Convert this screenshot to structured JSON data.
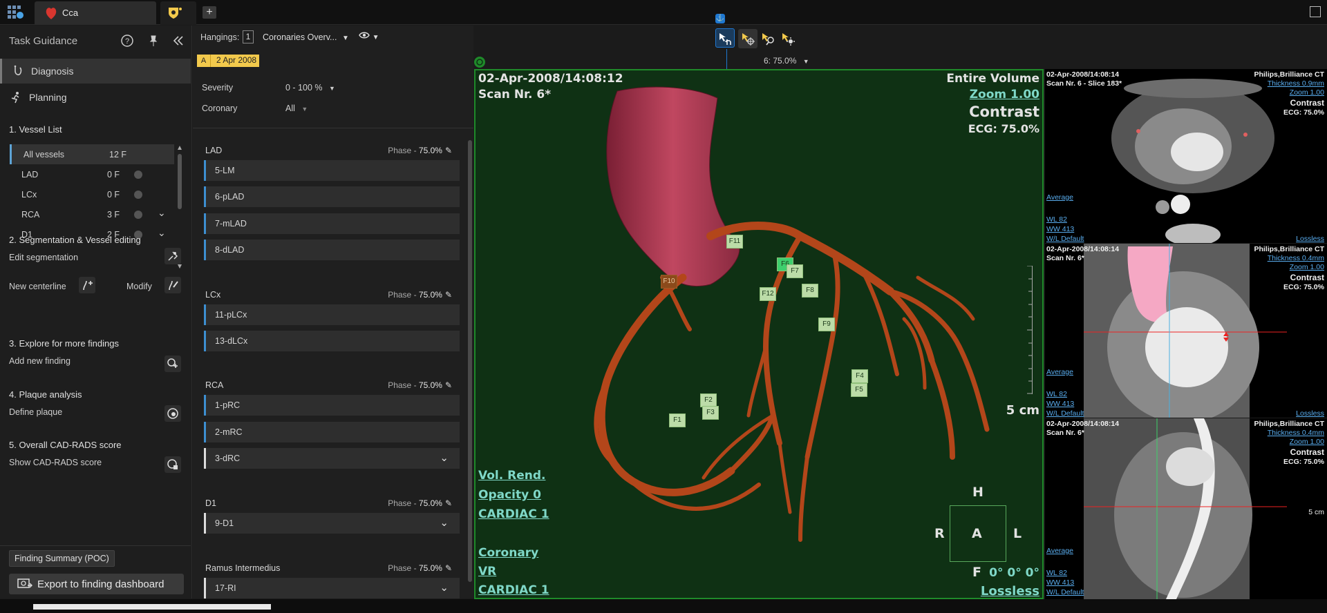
{
  "topbar": {
    "tab_title": "Cca",
    "new_tab_symbol": "+"
  },
  "left": {
    "title": "Task Guidance",
    "nav": [
      {
        "label": "Diagnosis",
        "icon": "diagnosis-icon",
        "active": true
      },
      {
        "label": "Planning",
        "icon": "planning-icon",
        "active": false
      }
    ],
    "sections": {
      "s1": "1.  Vessel List",
      "s2": "2.  Segmentation & Vessel editing",
      "s2_row1": "Edit segmentation",
      "s2_row2a": "New centerline",
      "s2_row2b": "Modify",
      "s3": "3.  Explore for more findings",
      "s3_row": "Add new finding",
      "s4": "4.  Plaque analysis",
      "s4_row": "Define plaque",
      "s5": "5.  Overall CAD-RADS score",
      "s5_row": "Show CAD-RADS score"
    },
    "vessels": [
      {
        "name": "All vessels",
        "count": "12 F"
      },
      {
        "name": "LAD",
        "count": "0 F"
      },
      {
        "name": "LCx",
        "count": "0 F"
      },
      {
        "name": "RCA",
        "count": "3 F"
      },
      {
        "name": "D1",
        "count": "2 F"
      }
    ],
    "finding_summary": "Finding Summary (POC)",
    "export": "Export to finding dashboard"
  },
  "mid": {
    "hangings_label": "Hangings:",
    "hangings_value": "1",
    "hanging_select": "Coronaries Overv...",
    "date_chip": "2 Apr 2008",
    "date_badge": "A",
    "severity_label": "Severity",
    "severity_value": "0 - 100 %",
    "coronary_label": "Coronary",
    "coronary_value": "All",
    "phase_prefix": "Phase - ",
    "phase_value": "75.0%",
    "groups": [
      {
        "title": "LAD",
        "rows": [
          "5-LM",
          "6-pLAD",
          "7-mLAD",
          "8-dLAD"
        ]
      },
      {
        "title": "LCx",
        "rows": [
          "11-pLCx",
          "13-dLCx"
        ]
      },
      {
        "title": "RCA",
        "rows": [
          "1-pRC",
          "2-mRC",
          "3-dRC"
        ]
      },
      {
        "title": "D1",
        "rows": [
          "9-D1"
        ]
      },
      {
        "title": "Ramus Intermedius",
        "rows": [
          "17-RI"
        ]
      }
    ]
  },
  "center": {
    "phase_select": "6: 75.0%"
  },
  "viewport": {
    "date": "02-Apr-2008/14:08:12",
    "scan": "Scan Nr. 6*",
    "volume": "Entire Volume",
    "zoom": "Zoom 1.00",
    "contrast": "Contrast",
    "ecg": "ECG: 75.0%",
    "scale": "5 cm",
    "render1": "Vol. Rend.",
    "render2": "Opacity  0",
    "render3": "CARDIAC 1",
    "render4": "Coronary",
    "render5": "VR",
    "render6": "CARDIAC 1",
    "orient_top": "H",
    "orient_left": "R",
    "orient_center": "A",
    "orient_right": "L",
    "orient_bottom": "F",
    "angles": "0° 0° 0°",
    "compression": "Lossless",
    "findings": [
      "F1",
      "F2",
      "F3",
      "F4",
      "F5",
      "F6",
      "F7",
      "F8",
      "F9",
      "F10",
      "F11",
      "F12"
    ]
  },
  "thumbs": [
    {
      "date": "02-Apr-2008/14:08:14",
      "scan": "Scan Nr. 6 - Slice 183*",
      "vendor": "Philips,Brilliance CT",
      "thickness": "Thickness 0.9mm",
      "zoom": "Zoom 1.00",
      "contrast": "Contrast",
      "ecg": "ECG: 75.0%",
      "average": "Average",
      "wl": "WL      82",
      "ww": "WW     413",
      "wl_default": "W/L Default",
      "lossless": "Lossless"
    },
    {
      "date": "02-Apr-2008/14:08:14",
      "scan": "Scan Nr. 6*",
      "vendor": "Philips,Brilliance CT",
      "thickness": "Thickness 0.4mm",
      "zoom": "Zoom 1.00",
      "contrast": "Contrast",
      "ecg": "ECG: 75.0%",
      "average": "Average",
      "wl": "WL      82",
      "ww": "WW     413",
      "wl_default": "W/L Default",
      "lossless": "Lossless"
    },
    {
      "date": "02-Apr-2008/14:08:14",
      "scan": "Scan Nr. 6*",
      "vendor": "Philips,Brilliance CT",
      "thickness": "Thickness 0.4mm",
      "zoom": "Zoom 1.00",
      "contrast": "Contrast",
      "ecg": "ECG: 75.0%",
      "average": "Average",
      "wl": "WL      82",
      "ww": "WW     413",
      "wl_default": "W/L Default",
      "scale": "5 cm"
    }
  ],
  "colors": {
    "accent": "#1f78d1",
    "viewport_border": "#1f8a2a",
    "date_chip": "#f2c94c",
    "finding_marker": "#bcdca8",
    "vessel": "#b3461a",
    "aorta": "#c04760"
  }
}
